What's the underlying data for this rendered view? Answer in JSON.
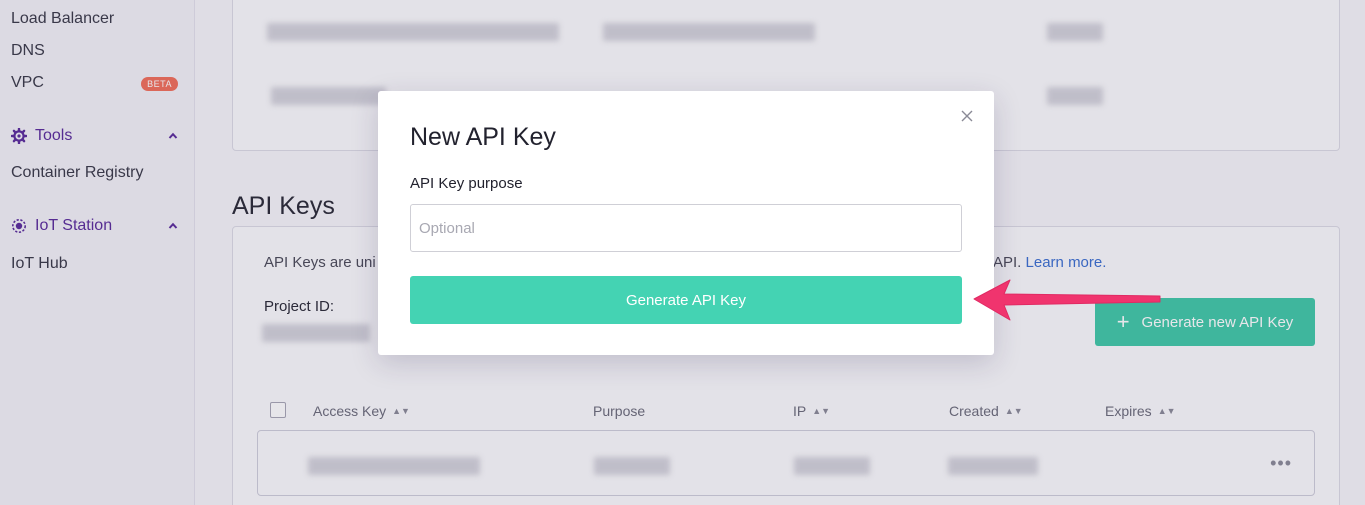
{
  "sidebar": {
    "links": [
      "Load Balancer",
      "DNS",
      "VPC"
    ],
    "beta_badge": "BETA",
    "tools": {
      "label": "Tools",
      "items": [
        "Container Registry"
      ]
    },
    "iot": {
      "label": "IoT Station",
      "items": [
        "IoT Hub"
      ]
    }
  },
  "main": {
    "section_title": "API Keys",
    "description_start": "API Keys are uni",
    "description_end": "API.",
    "learn_more": "Learn more.",
    "project_id_label": "Project ID:",
    "generate_new_label": "Generate new API Key",
    "table": {
      "headers": [
        "Access Key",
        "Purpose",
        "IP",
        "Created",
        "Expires"
      ],
      "row_menu": "•••"
    }
  },
  "modal": {
    "title": "New API Key",
    "field_label": "API Key purpose",
    "field_placeholder": "Optional",
    "field_value": "",
    "submit_label": "Generate API Key"
  },
  "colors": {
    "accent": "#44d3b3",
    "brand_purple": "#5a2c9b",
    "annotation_arrow": "#f0346e",
    "beta_badge": "#f26f5a"
  },
  "icons": {
    "tools": "gear-icon",
    "iot": "iot-icon",
    "close": "close-icon",
    "add": "plus-icon",
    "sort": "sort-icon",
    "menu": "more-icon"
  }
}
